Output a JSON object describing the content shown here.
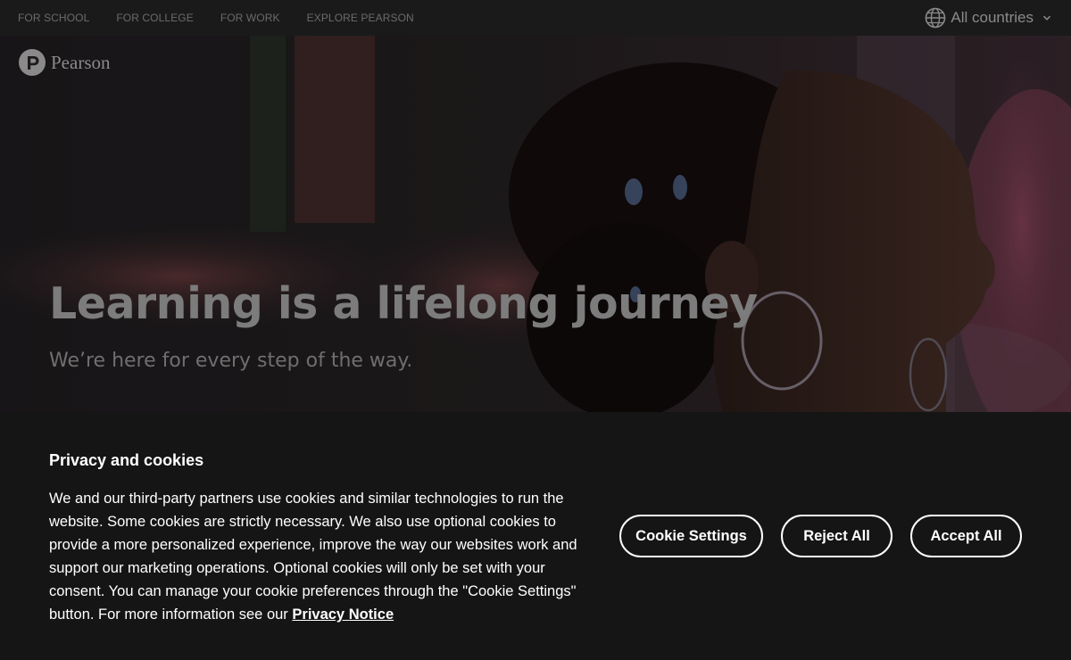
{
  "topnav": {
    "links": [
      "FOR SCHOOL",
      "FOR COLLEGE",
      "FOR WORK",
      "EXPLORE PEARSON"
    ],
    "country": "All countries"
  },
  "hero": {
    "logo_text": "Pearson",
    "title": "Learning is a lifelong journey",
    "subtitle": "We’re here for every step of the way."
  },
  "cookie_banner": {
    "title": "Privacy and cookies",
    "body": "We and our third-party partners use cookies and similar technologies to run the website. Some cookies are strictly necessary. We also use optional cookies to provide a more personalized experience, improve the way our websites work and support our marketing operations. Optional cookies will only be set with your consent. You can manage your cookie preferences through the \"Cookie Settings\" button. For more information see our",
    "privacy_link": "Privacy Notice",
    "settings_label": "Cookie Settings",
    "reject_label": "Reject All",
    "accept_label": "Accept All"
  },
  "colors": {
    "banner_bg": "#151515",
    "nav_bg": "#1a1a1a",
    "button_border": "#ffffff"
  }
}
